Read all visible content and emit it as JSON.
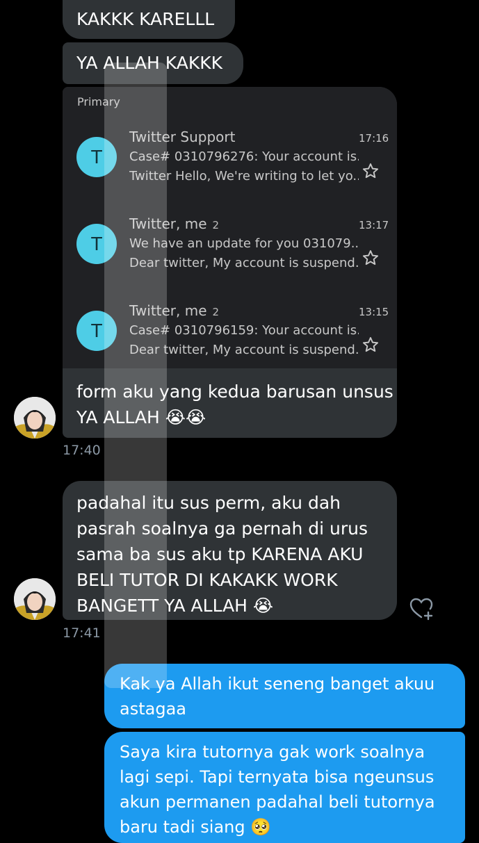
{
  "messages_in": [
    {
      "text": "KAKKK KARELLL"
    },
    {
      "text": "YA ALLAH KAKKK"
    }
  ],
  "inbox": {
    "section_label": "Primary",
    "emails": [
      {
        "avatar_letter": "T",
        "sender": "Twitter Support",
        "count": "",
        "time": "17:16",
        "subject": "Case# 0310796276: Your account is...",
        "snippet": "Twitter Hello, We're writing to let yo..."
      },
      {
        "avatar_letter": "T",
        "sender": "Twitter, me",
        "count": "2",
        "time": "13:17",
        "subject": "We have an update for you 031079...",
        "snippet": "Dear twitter, My account is suspend..."
      },
      {
        "avatar_letter": "T",
        "sender": "Twitter, me",
        "count": "2",
        "time": "13:15",
        "subject": "Case# 0310796159: Your account is...",
        "snippet": "Dear twitter, My account is suspend..."
      }
    ]
  },
  "message_form": {
    "line1": "form aku yang kedua barusan unsus",
    "line2": "YA ALLAH 😭😭",
    "time": "17:40"
  },
  "message_padahal": {
    "lines": [
      "padahal itu sus perm, aku dah",
      "pasrah soalnya ga pernah di urus",
      "sama ba sus aku tp KARENA AKU",
      "BELI TUTOR DI KAKAKK WORK",
      "BANGETT YA ALLAH 😭"
    ],
    "time": "17:41"
  },
  "messages_out": [
    {
      "lines": [
        "Kak ya Allah ikut seneng banget akuu",
        "astagaa"
      ]
    },
    {
      "lines": [
        "Saya kira tutornya gak work soalnya",
        "lagi sepi. Tapi ternyata bisa ngeunsus",
        "akun permanen padahal beli tutornya",
        "baru tadi siang 🥺"
      ]
    }
  ],
  "colors": {
    "background": "#000000",
    "incoming_bubble": "#2f3336",
    "outgoing_bubble": "#1d9bf0",
    "timestamp": "#8b98a5",
    "mail_avatar": "#4ecde6"
  },
  "icons": {
    "star": "star-icon",
    "react": "heart-add-icon"
  }
}
